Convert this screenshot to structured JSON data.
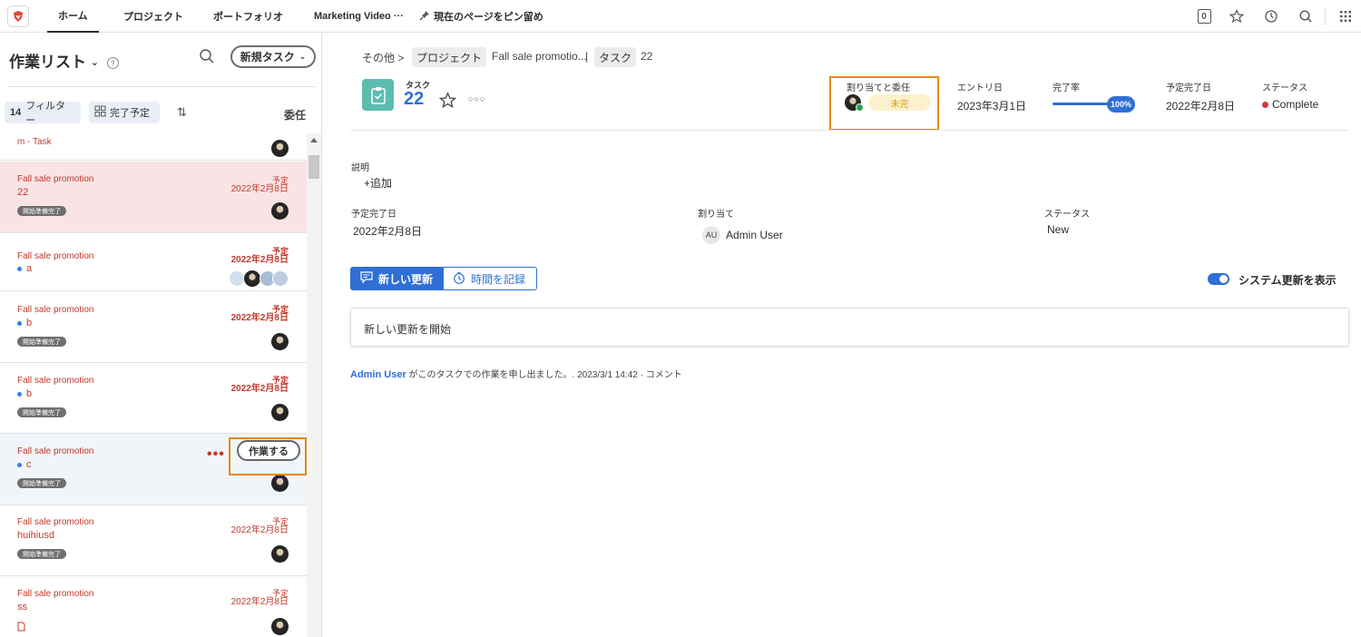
{
  "nav": {
    "tabs": [
      "ホーム",
      "プロジェクト",
      "ポートフォリオ",
      "Marketing Video ···"
    ],
    "pin_label": "現在のページをピン留め",
    "badge_count": "0"
  },
  "left": {
    "title": "作業リスト",
    "new_task": "新規タスク",
    "filter_count": "14",
    "filter_label": "フィルター",
    "sort_chip": "完了予定",
    "assign_header": "委任",
    "items": [
      {
        "name": "m - Task"
      },
      {
        "project": "Fall sale promotion",
        "name": "22",
        "due_label": "予定",
        "due_date": "2022年2月8日",
        "badge": "開始準備完了"
      },
      {
        "project": "Fall sale promotion",
        "name": "a",
        "due_label": "予定",
        "due_date": "2022年2月8日"
      },
      {
        "project": "Fall sale promotion",
        "name": "b",
        "due_label": "予定",
        "due_date": "2022年2月8日",
        "badge": "開始準備完了"
      },
      {
        "project": "Fall sale promotion",
        "name": "b",
        "due_label": "予定",
        "due_date": "2022年2月8日",
        "badge": "開始準備完了"
      },
      {
        "project": "Fall sale promotion",
        "name": "c",
        "badge": "開始準備完了",
        "work_button": "作業する"
      },
      {
        "project": "Fall sale promotion",
        "name": "huihiusd",
        "due_label": "予定",
        "due_date": "2022年2月8日",
        "badge": "開始準備完了"
      },
      {
        "project": "Fall sale promotion",
        "name": "ss",
        "due_label": "予定",
        "due_date": "2022年2月8日"
      }
    ]
  },
  "breadcrumb": {
    "other": "その他",
    "sep": ">",
    "project_label": "プロジェクト",
    "project_name": "Fall sale promotio...",
    "pipe": "|",
    "task_label": "タスク",
    "task_id": "22"
  },
  "task": {
    "type": "タスク",
    "number": "22",
    "more": "○○○",
    "assign_label": "割り当てと委任",
    "status_pill": "未完",
    "entry_label": "エントリ日",
    "entry_date": "2023年3月1日",
    "progress_label": "完了率",
    "progress_value": "100%",
    "planned_label": "予定完了日",
    "planned_date": "2022年2月8日",
    "status_label": "ステータス",
    "status_value": "Complete"
  },
  "details": {
    "desc_label": "説明",
    "add_label": "+追加",
    "planned_label": "予定完了日",
    "planned_value": "2022年2月8日",
    "assign_label": "割り当て",
    "assignee_initials": "AU",
    "assignee_name": "Admin User",
    "status_label": "ステータス",
    "status_value": "New"
  },
  "updates": {
    "tab_new": "新しい更新",
    "tab_time": "時間を記録",
    "system_toggle": "システム更新を表示",
    "placeholder": "新しい更新を開始",
    "activity_user": "Admin User",
    "activity_text": "がこのタスクでの作業を申し出ました。. 2023/3/1 14:42 · コメント"
  },
  "colors": {
    "accent": "#2f6fd6",
    "due_red": "#c0392b",
    "highlight": "#e2891a",
    "task_icon": "#5dbcb0"
  }
}
